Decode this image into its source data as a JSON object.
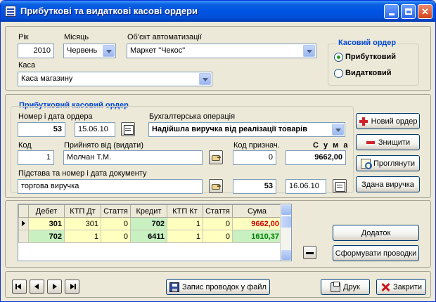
{
  "window": {
    "title": "Прибуткові та видаткові касові ордери"
  },
  "filters": {
    "year_label": "Рік",
    "year_value": "2010",
    "month_label": "Місяць",
    "month_value": "Червень",
    "object_label": "Об'єкт автоматизації",
    "object_value": "Маркет \"Чекос\"",
    "cash_label": "Каса",
    "cash_value": "Каса магазину"
  },
  "order_type": {
    "title": "Касовий ордер",
    "options": [
      {
        "label": "Прибутковий",
        "selected": true
      },
      {
        "label": "Видатковий",
        "selected": false
      }
    ]
  },
  "order": {
    "section_title": "Прибутковий касовий ордер",
    "number_label": "Номер і дата ордера",
    "number": "53",
    "date": "15.06.10",
    "operation_label": "Бухгалтерська операція",
    "operation": "Надійшла виручка від реалізації товарів",
    "code_label": "Код",
    "code": "1",
    "received_label": "Прийнято від (видати)",
    "received": "Молчан Т.М.",
    "purpose_label": "Код признач.",
    "purpose": "0",
    "sum_label": "С у м а",
    "sum": "9662,00",
    "basis_label": "Підстава та номер і дата документу",
    "basis": "торгова виручка",
    "doc_number": "53",
    "doc_date": "16.06.10"
  },
  "actions": {
    "new_order": "Новий ордер",
    "delete": "Знищити",
    "view": "Проглянути",
    "revenue": "Здана виручка",
    "addition": "Додаток",
    "form_entries": "Сформувати проводки"
  },
  "entries_table": {
    "columns": [
      "Дебет",
      "КТП Дт",
      "Стаття",
      "Кредит",
      "КТП Кт",
      "Стаття",
      "Сума"
    ],
    "rows": [
      [
        "301",
        "301",
        "0",
        "702",
        "1",
        "0",
        "9662,00"
      ],
      [
        "702",
        "1",
        "0",
        "6411",
        "1",
        "0",
        "1610,37"
      ]
    ]
  },
  "footer": {
    "save_entries": "Запис проводок у файл",
    "print": "Друк",
    "close": "Закрити"
  },
  "colors": {
    "title_bar": "#0054e3",
    "group_title": "#0046d5",
    "sum_red": "#cc0000",
    "row_yellow": "#ffffc0",
    "row_green": "#c8f0c0"
  }
}
